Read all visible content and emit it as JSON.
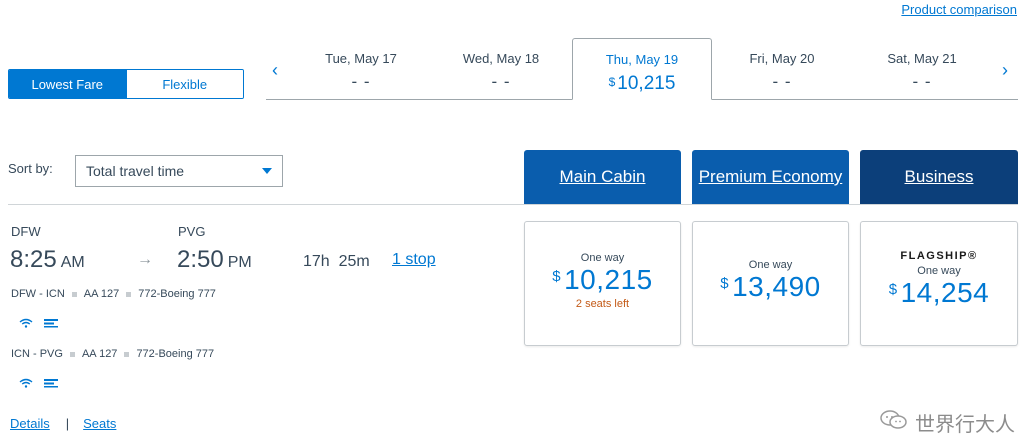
{
  "header": {
    "product_comparison": "Product comparison"
  },
  "fare_toggle": {
    "lowest_fare": "Lowest Fare",
    "flexible": "Flexible",
    "selected": "Lowest Fare"
  },
  "date_strip": {
    "prev_icon": "chevron-left-icon",
    "next_icon": "chevron-right-icon",
    "dates": [
      {
        "label": "Tue, May 17",
        "price": "- -"
      },
      {
        "label": "Wed, May 18",
        "price": "- -"
      },
      {
        "label": "Thu, May 19",
        "currency": "$",
        "price": "10,215",
        "selected": true
      },
      {
        "label": "Fri, May 20",
        "price": "- -"
      },
      {
        "label": "Sat, May 21",
        "price": "- -"
      }
    ]
  },
  "sort": {
    "label": "Sort by:",
    "value": "Total travel time"
  },
  "cabins": [
    {
      "label": "Main Cabin",
      "color": "#0a5dad"
    },
    {
      "label": "Premium Economy",
      "color": "#0a5dad"
    },
    {
      "label": "Business",
      "color": "#0c3f7a"
    }
  ],
  "flight": {
    "origin": "DFW",
    "destination": "PVG",
    "depart_time": "8:25",
    "depart_ampm": "AM",
    "arrive_time": "2:50",
    "arrive_ampm": "PM",
    "duration_h": "17h",
    "duration_m": "25m",
    "stops": "1 stop",
    "legs": [
      {
        "route": "DFW - ICN",
        "flight": "AA 127",
        "aircraft": "772-Boeing 777",
        "amenities": [
          "wifi-icon",
          "seat-power-icon"
        ]
      },
      {
        "route": "ICN - PVG",
        "flight": "AA 127",
        "aircraft": "772-Boeing 777",
        "amenities": [
          "wifi-icon",
          "seat-power-icon"
        ]
      }
    ]
  },
  "fares": [
    {
      "tag": "",
      "label": "One way",
      "currency": "$",
      "price": "10,215",
      "note": "2 seats left"
    },
    {
      "tag": "",
      "label": "One way",
      "currency": "$",
      "price": "13,490",
      "note": ""
    },
    {
      "tag": "FLAGSHIP®",
      "label": "One way",
      "currency": "$",
      "price": "14,254",
      "note": ""
    }
  ],
  "links": {
    "details": "Details",
    "separator": "|",
    "seats": "Seats"
  },
  "watermark": {
    "text": "世界行大人"
  },
  "colors": {
    "accent": "#0078d2",
    "header_blue": "#0a5dad",
    "header_dark": "#0c3f7a",
    "warning": "#c35a17"
  }
}
